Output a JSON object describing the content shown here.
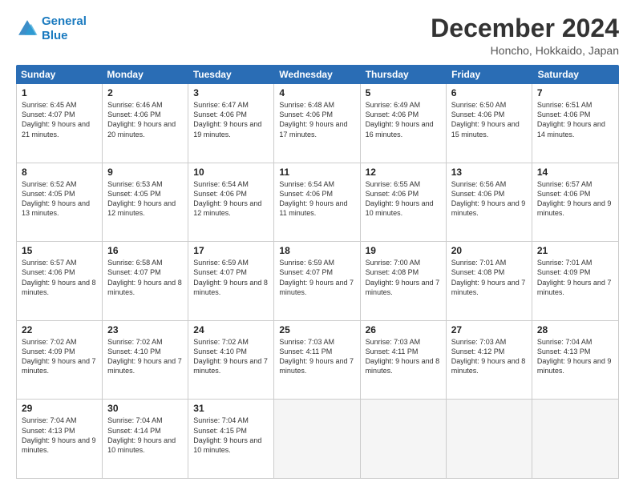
{
  "logo": {
    "line1": "General",
    "line2": "Blue"
  },
  "title": "December 2024",
  "location": "Honcho, Hokkaido, Japan",
  "header": {
    "days": [
      "Sunday",
      "Monday",
      "Tuesday",
      "Wednesday",
      "Thursday",
      "Friday",
      "Saturday"
    ]
  },
  "weeks": [
    [
      {
        "day": "1",
        "sunrise": "6:45 AM",
        "sunset": "4:07 PM",
        "daylight": "9 hours and 21 minutes."
      },
      {
        "day": "2",
        "sunrise": "6:46 AM",
        "sunset": "4:06 PM",
        "daylight": "9 hours and 20 minutes."
      },
      {
        "day": "3",
        "sunrise": "6:47 AM",
        "sunset": "4:06 PM",
        "daylight": "9 hours and 19 minutes."
      },
      {
        "day": "4",
        "sunrise": "6:48 AM",
        "sunset": "4:06 PM",
        "daylight": "9 hours and 17 minutes."
      },
      {
        "day": "5",
        "sunrise": "6:49 AM",
        "sunset": "4:06 PM",
        "daylight": "9 hours and 16 minutes."
      },
      {
        "day": "6",
        "sunrise": "6:50 AM",
        "sunset": "4:06 PM",
        "daylight": "9 hours and 15 minutes."
      },
      {
        "day": "7",
        "sunrise": "6:51 AM",
        "sunset": "4:06 PM",
        "daylight": "9 hours and 14 minutes."
      }
    ],
    [
      {
        "day": "8",
        "sunrise": "6:52 AM",
        "sunset": "4:05 PM",
        "daylight": "9 hours and 13 minutes."
      },
      {
        "day": "9",
        "sunrise": "6:53 AM",
        "sunset": "4:05 PM",
        "daylight": "9 hours and 12 minutes."
      },
      {
        "day": "10",
        "sunrise": "6:54 AM",
        "sunset": "4:06 PM",
        "daylight": "9 hours and 12 minutes."
      },
      {
        "day": "11",
        "sunrise": "6:54 AM",
        "sunset": "4:06 PM",
        "daylight": "9 hours and 11 minutes."
      },
      {
        "day": "12",
        "sunrise": "6:55 AM",
        "sunset": "4:06 PM",
        "daylight": "9 hours and 10 minutes."
      },
      {
        "day": "13",
        "sunrise": "6:56 AM",
        "sunset": "4:06 PM",
        "daylight": "9 hours and 9 minutes."
      },
      {
        "day": "14",
        "sunrise": "6:57 AM",
        "sunset": "4:06 PM",
        "daylight": "9 hours and 9 minutes."
      }
    ],
    [
      {
        "day": "15",
        "sunrise": "6:57 AM",
        "sunset": "4:06 PM",
        "daylight": "9 hours and 8 minutes."
      },
      {
        "day": "16",
        "sunrise": "6:58 AM",
        "sunset": "4:07 PM",
        "daylight": "9 hours and 8 minutes."
      },
      {
        "day": "17",
        "sunrise": "6:59 AM",
        "sunset": "4:07 PM",
        "daylight": "9 hours and 8 minutes."
      },
      {
        "day": "18",
        "sunrise": "6:59 AM",
        "sunset": "4:07 PM",
        "daylight": "9 hours and 7 minutes."
      },
      {
        "day": "19",
        "sunrise": "7:00 AM",
        "sunset": "4:08 PM",
        "daylight": "9 hours and 7 minutes."
      },
      {
        "day": "20",
        "sunrise": "7:01 AM",
        "sunset": "4:08 PM",
        "daylight": "9 hours and 7 minutes."
      },
      {
        "day": "21",
        "sunrise": "7:01 AM",
        "sunset": "4:09 PM",
        "daylight": "9 hours and 7 minutes."
      }
    ],
    [
      {
        "day": "22",
        "sunrise": "7:02 AM",
        "sunset": "4:09 PM",
        "daylight": "9 hours and 7 minutes."
      },
      {
        "day": "23",
        "sunrise": "7:02 AM",
        "sunset": "4:10 PM",
        "daylight": "9 hours and 7 minutes."
      },
      {
        "day": "24",
        "sunrise": "7:02 AM",
        "sunset": "4:10 PM",
        "daylight": "9 hours and 7 minutes."
      },
      {
        "day": "25",
        "sunrise": "7:03 AM",
        "sunset": "4:11 PM",
        "daylight": "9 hours and 7 minutes."
      },
      {
        "day": "26",
        "sunrise": "7:03 AM",
        "sunset": "4:11 PM",
        "daylight": "9 hours and 8 minutes."
      },
      {
        "day": "27",
        "sunrise": "7:03 AM",
        "sunset": "4:12 PM",
        "daylight": "9 hours and 8 minutes."
      },
      {
        "day": "28",
        "sunrise": "7:04 AM",
        "sunset": "4:13 PM",
        "daylight": "9 hours and 9 minutes."
      }
    ],
    [
      {
        "day": "29",
        "sunrise": "7:04 AM",
        "sunset": "4:13 PM",
        "daylight": "9 hours and 9 minutes."
      },
      {
        "day": "30",
        "sunrise": "7:04 AM",
        "sunset": "4:14 PM",
        "daylight": "9 hours and 10 minutes."
      },
      {
        "day": "31",
        "sunrise": "7:04 AM",
        "sunset": "4:15 PM",
        "daylight": "9 hours and 10 minutes."
      },
      null,
      null,
      null,
      null
    ]
  ]
}
